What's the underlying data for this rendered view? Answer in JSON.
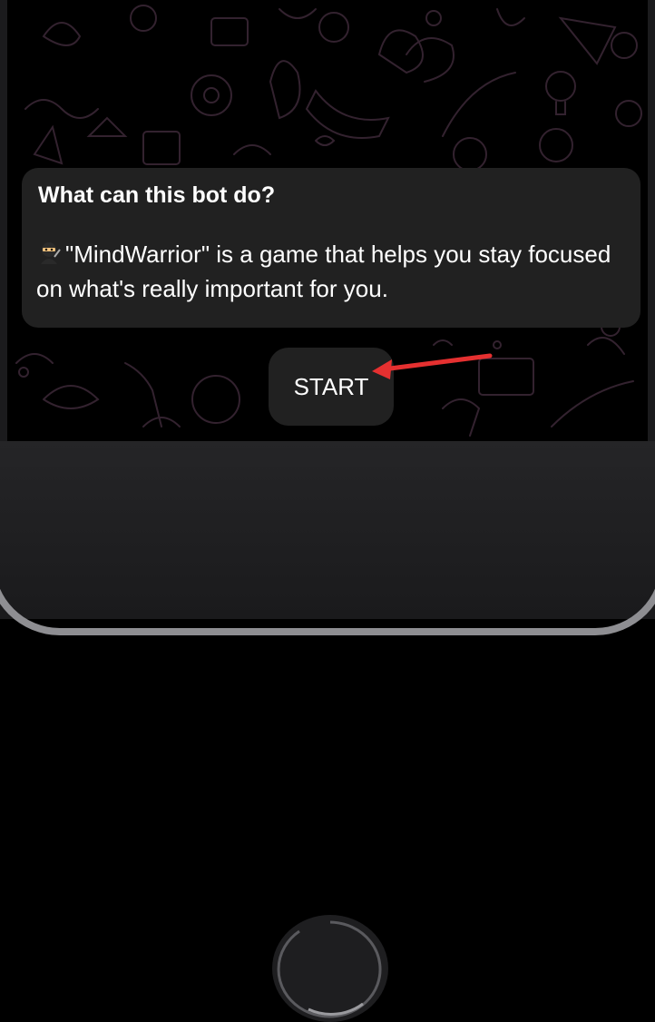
{
  "bot_info": {
    "title": "What can this bot do?",
    "description": "\"MindWarrior\" is a game that helps you stay focused on what's really important for you.",
    "description_icon": "ninja-icon"
  },
  "start_button": {
    "label": "START"
  },
  "annotation": {
    "arrow_color": "#e53030",
    "points_to": "start-button"
  },
  "colors": {
    "chat_background": "#000000",
    "bubble": "#212121",
    "doodle": "#2c1f2c",
    "bezel": "#1f1f21",
    "frame_edge": "#8e8e92"
  }
}
